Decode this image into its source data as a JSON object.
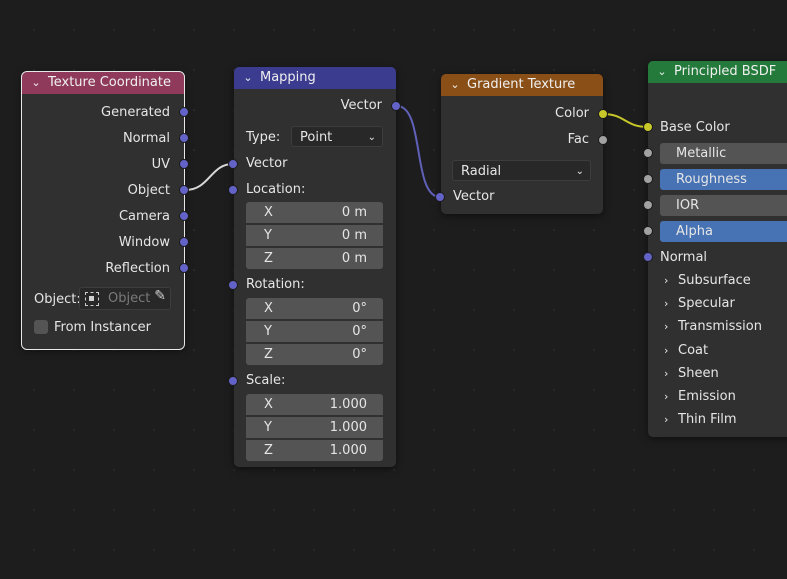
{
  "texture_coordinate": {
    "title": "Texture Coordinate",
    "outputs": [
      "Generated",
      "Normal",
      "UV",
      "Object",
      "Camera",
      "Window",
      "Reflection"
    ],
    "object_label": "Object:",
    "object_placeholder": "Object",
    "from_instancer": "From Instancer",
    "header_color": "#8f3a5a"
  },
  "mapping": {
    "title": "Mapping",
    "output": "Vector",
    "type_label": "Type:",
    "type_value": "Point",
    "vector_input": "Vector",
    "location_label": "Location:",
    "location": [
      {
        "axis": "X",
        "value": "0 m"
      },
      {
        "axis": "Y",
        "value": "0 m"
      },
      {
        "axis": "Z",
        "value": "0 m"
      }
    ],
    "rotation_label": "Rotation:",
    "rotation": [
      {
        "axis": "X",
        "value": "0°"
      },
      {
        "axis": "Y",
        "value": "0°"
      },
      {
        "axis": "Z",
        "value": "0°"
      }
    ],
    "scale_label": "Scale:",
    "scale": [
      {
        "axis": "X",
        "value": "1.000"
      },
      {
        "axis": "Y",
        "value": "1.000"
      },
      {
        "axis": "Z",
        "value": "1.000"
      }
    ],
    "header_color": "#3b3b8f"
  },
  "gradient_texture": {
    "title": "Gradient Texture",
    "outputs": [
      "Color",
      "Fac"
    ],
    "gradient_type": "Radial",
    "vector_input": "Vector",
    "header_color": "#8a4f17"
  },
  "principled_bsdf": {
    "title": "Principled BSDF",
    "base_color": "Base Color",
    "fields": [
      "Metallic",
      "Roughness",
      "IOR",
      "Alpha"
    ],
    "normal": "Normal",
    "panels": [
      "Subsurface",
      "Specular",
      "Transmission",
      "Coat",
      "Sheen",
      "Emission",
      "Thin Film"
    ],
    "header_color": "#237a3a"
  }
}
